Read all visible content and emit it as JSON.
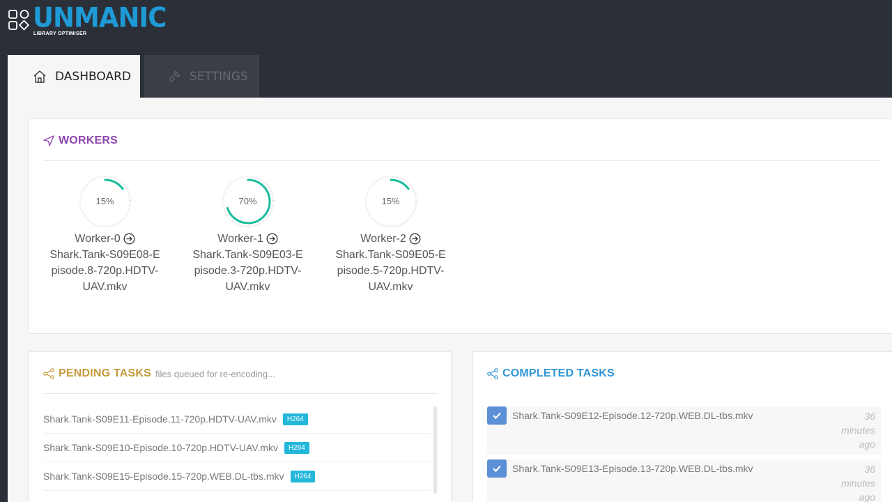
{
  "app": {
    "logo_text": "UNMANIC",
    "logo_subtitle": "LIBRARY OPTIMISER"
  },
  "tabs": [
    {
      "label": "DASHBOARD",
      "icon": "home-icon",
      "active": true
    },
    {
      "label": "SETTINGS",
      "icon": "wrench-icon",
      "active": false
    }
  ],
  "workers": {
    "title": "WORKERS",
    "icon": "send-icon",
    "items": [
      {
        "name": "Worker-0",
        "progress_label": "15%",
        "progress": 15,
        "file": "Shark.Tank-S09E08-Episode.8-720p.HDTV-UAV.mkv"
      },
      {
        "name": "Worker-1",
        "progress_label": "70%",
        "progress": 70,
        "file": "Shark.Tank-S09E03-Episode.3-720p.HDTV-UAV.mkv"
      },
      {
        "name": "Worker-2",
        "progress_label": "15%",
        "progress": 15,
        "file": "Shark.Tank-S09E05-Episode.5-720p.HDTV-UAV.mkv"
      }
    ]
  },
  "pending": {
    "title": "PENDING TASKS",
    "subtitle": "files queued for re-encoding...",
    "icon": "share-icon",
    "items": [
      {
        "file": "Shark.Tank-S09E11-Episode.11-720p.HDTV-UAV.mkv",
        "codec": "H264"
      },
      {
        "file": "Shark.Tank-S09E10-Episode.10-720p.HDTV-UAV.mkv",
        "codec": "H264"
      },
      {
        "file": "Shark.Tank-S09E15-Episode.15-720p.WEB.DL-tbs.mkv",
        "codec": "H264"
      }
    ]
  },
  "completed": {
    "title": "COMPLETED TASKS",
    "icon": "share-icon",
    "items": [
      {
        "file": "Shark.Tank-S09E12-Episode.12-720p.WEB.DL-tbs.mkv",
        "time": "36 minutes ago"
      },
      {
        "file": "Shark.Tank-S09E13-Episode.13-720p.WEB.DL-tbs.mkv",
        "time": "36 minutes ago"
      }
    ]
  },
  "colors": {
    "brand": "#1e9ad6",
    "topbar": "#2b3038",
    "gauge": "#1abc9c",
    "workers_title": "#8e44ad",
    "pending_title": "#c49a3c",
    "completed_title": "#2f95d6",
    "badge": "#23b7d9",
    "check": "#5b8fd6"
  }
}
